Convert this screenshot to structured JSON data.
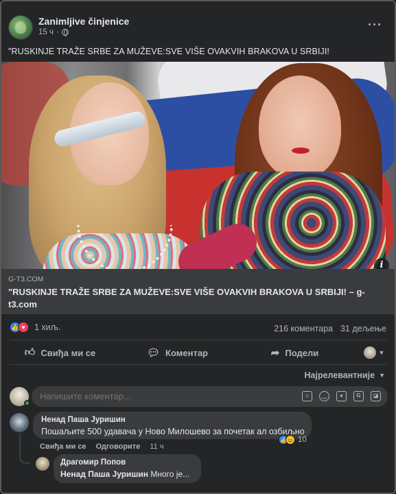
{
  "post": {
    "page_name": "Zanimljive činjenice",
    "time": "15 ч",
    "more_icon": "more-horiz-icon",
    "text": "\"RUSKINJE TRAŽE SRBE ZA MUŽEVE:SVE VIŠE OVAKVIH BRAKOVA U SRBIJI!"
  },
  "link": {
    "domain": "G-T3.COM",
    "title": "\"RUSKINJE TRAŽE SRBE ZA MUŽEVE:SVE VIŠE OVAKVIH BRAKOVA U SRBIJI! – g-t3.com"
  },
  "stats": {
    "reactions_count": "1 хиљ.",
    "comments": "216 коментара",
    "shares": "31 дељење"
  },
  "actions": {
    "like": "Свиђа ми се",
    "comment": "Коментар",
    "share": "Подели"
  },
  "sort_label": "Најрелевантније",
  "composer": {
    "placeholder": "Напишите коментар..."
  },
  "comments": [
    {
      "author": "Ненад Паша Јуришин",
      "text": "Пошаљите 500 удавача у Ново Милошево за почетак ал озбиљно",
      "reaction_count": "10",
      "like_label": "Свиђа ми се",
      "reply_label": "Одговорите",
      "time": "11 ч"
    },
    {
      "author": "Драгомир Попов",
      "mention": "Ненад Паша Јуришин",
      "text": " Много је..."
    }
  ],
  "colors": {
    "background": "#242526",
    "bubble": "#3a3b3c",
    "text_primary": "#e4e6eb",
    "text_secondary": "#b0b3b8",
    "like_blue": "#2d88ff",
    "love_red": "#f33e58"
  }
}
